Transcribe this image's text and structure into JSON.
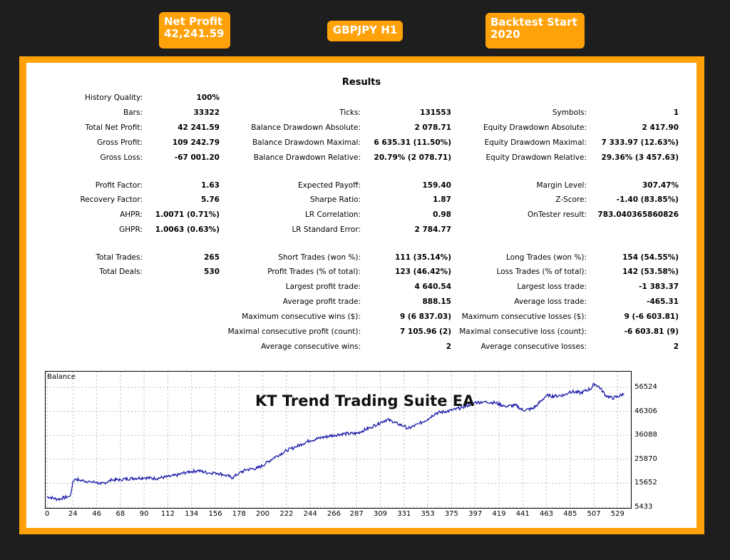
{
  "badges": {
    "net_profit_title": "Net Profit",
    "net_profit_value": "42,241.59",
    "symbol": "GBPJPY H1",
    "backtest_title": "Backtest Start",
    "backtest_value": "2020"
  },
  "colors": {
    "accent": "#ffa20a",
    "background": "#1e1e1e",
    "balance_line": "#1a1aa8"
  },
  "report": {
    "title": "Results",
    "col1": [
      {
        "label": "History Quality:",
        "value": "100%"
      },
      {
        "label": "Bars:",
        "value": "33322"
      },
      {
        "label": "Total Net Profit:",
        "value": "42 241.59"
      },
      {
        "label": "Gross Profit:",
        "value": "109 242.79"
      },
      {
        "label": "Gross Loss:",
        "value": "-67 001.20"
      },
      {
        "label": "Profit Factor:",
        "value": "1.63"
      },
      {
        "label": "Recovery Factor:",
        "value": "5.76"
      },
      {
        "label": "AHPR:",
        "value": "1.0071 (0.71%)"
      },
      {
        "label": "GHPR:",
        "value": "1.0063 (0.63%)"
      },
      {
        "label": "Total Trades:",
        "value": "265"
      },
      {
        "label": "Total Deals:",
        "value": "530"
      }
    ],
    "col2": [
      {
        "label": "Ticks:",
        "value": "131553"
      },
      {
        "label": "Balance Drawdown Absolute:",
        "value": "2 078.71"
      },
      {
        "label": "Balance Drawdown Maximal:",
        "value": "6 635.31 (11.50%)"
      },
      {
        "label": "Balance Drawdown Relative:",
        "value": "20.79% (2 078.71)"
      },
      {
        "label": "Expected Payoff:",
        "value": "159.40"
      },
      {
        "label": "Sharpe Ratio:",
        "value": "1.87"
      },
      {
        "label": "LR Correlation:",
        "value": "0.98"
      },
      {
        "label": "LR Standard Error:",
        "value": "2 784.77"
      },
      {
        "label": "Short Trades (won %):",
        "value": "111 (35.14%)"
      },
      {
        "label": "Profit Trades (% of total):",
        "value": "123 (46.42%)"
      },
      {
        "label": "Largest profit trade:",
        "value": "4 640.54"
      },
      {
        "label": "Average profit trade:",
        "value": "888.15"
      },
      {
        "label": "Maximum consecutive wins ($):",
        "value": "9 (6 837.03)"
      },
      {
        "label": "Maximal consecutive profit (count):",
        "value": "7 105.96 (2)"
      },
      {
        "label": "Average consecutive wins:",
        "value": "2"
      }
    ],
    "col3": [
      {
        "label": "Symbols:",
        "value": "1"
      },
      {
        "label": "Equity Drawdown Absolute:",
        "value": "2 417.90"
      },
      {
        "label": "Equity Drawdown Maximal:",
        "value": "7 333.97 (12.63%)"
      },
      {
        "label": "Equity Drawdown Relative:",
        "value": "29.36% (3 457.63)"
      },
      {
        "label": "Margin Level:",
        "value": "307.47%"
      },
      {
        "label": "Z-Score:",
        "value": "-1.40 (83.85%)"
      },
      {
        "label": "OnTester result:",
        "value": "783.040365860826"
      },
      {
        "label": "Long Trades (won %):",
        "value": "154 (54.55%)"
      },
      {
        "label": "Loss Trades (% of total):",
        "value": "142 (53.58%)"
      },
      {
        "label": "Largest loss trade:",
        "value": "-1 383.37"
      },
      {
        "label": "Average loss trade:",
        "value": "-465.31"
      },
      {
        "label": "Maximum consecutive losses ($):",
        "value": "9 (-6 603.81)"
      },
      {
        "label": "Maximal consecutive loss (count):",
        "value": "-6 603.81 (9)"
      },
      {
        "label": "Average consecutive losses:",
        "value": "2"
      }
    ]
  },
  "chart_data": {
    "type": "line",
    "title": "Balance",
    "overlay_text": "KT Trend Trading Suite EA",
    "x_ticks": [
      0,
      24,
      46,
      68,
      90,
      112,
      134,
      156,
      178,
      200,
      222,
      244,
      266,
      287,
      309,
      331,
      353,
      375,
      397,
      419,
      441,
      463,
      485,
      507,
      529
    ],
    "y_ticks": [
      56524,
      46306,
      36088,
      25870,
      15652,
      5433
    ],
    "xlim": [
      0,
      540
    ],
    "ylim": [
      5433,
      56524
    ],
    "grid": true,
    "series": [
      {
        "x": [
          0,
          10,
          20,
          22,
          24,
          26,
          30,
          40,
          46,
          50,
          60,
          68,
          80,
          90,
          100,
          112,
          120,
          130,
          140,
          150,
          156,
          165,
          172,
          178,
          185,
          195,
          200,
          210,
          220,
          222,
          230,
          240,
          244,
          255,
          266,
          275,
          287,
          295,
          300,
          309,
          315,
          320,
          325,
          331,
          335,
          340,
          345,
          353,
          360,
          375,
          385,
          397,
          405,
          415,
          425,
          435,
          441,
          450,
          455,
          463,
          470,
          480,
          485,
          495,
          505,
          507,
          512,
          518,
          524,
          529,
          535
        ],
        "y": [
          10000,
          8800,
          10000,
          11000,
          16500,
          17600,
          17000,
          16300,
          16000,
          15300,
          17000,
          17200,
          17800,
          18000,
          17700,
          18400,
          19000,
          20500,
          21000,
          20000,
          20200,
          19200,
          18000,
          20000,
          21400,
          22100,
          23200,
          26500,
          29000,
          29600,
          31000,
          33200,
          33900,
          35100,
          36200,
          36700,
          36900,
          38500,
          39500,
          41500,
          42800,
          42000,
          41000,
          40000,
          39000,
          40000,
          41000,
          43000,
          45500,
          46700,
          48000,
          50000,
          50400,
          50000,
          48500,
          48800,
          46800,
          47400,
          49300,
          53100,
          52800,
          53300,
          54800,
          54200,
          56200,
          58200,
          56700,
          53100,
          51900,
          52600,
          53800
        ]
      }
    ]
  }
}
